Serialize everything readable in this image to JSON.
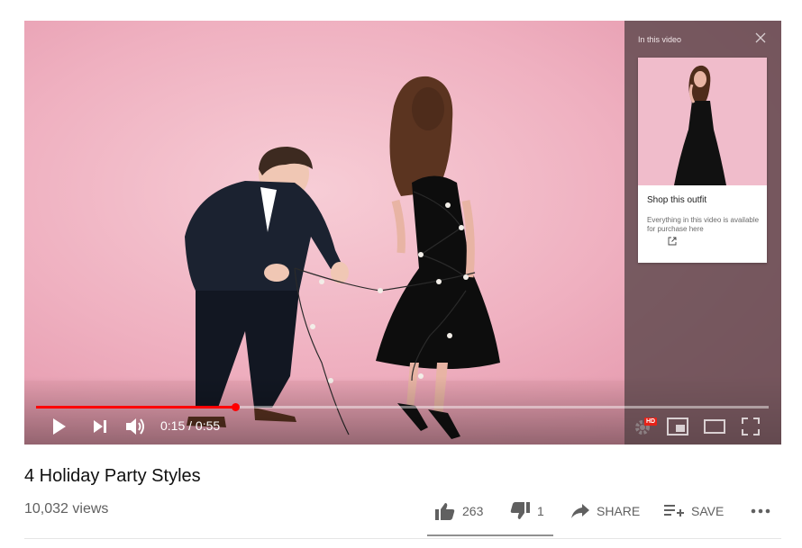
{
  "player": {
    "progress_fraction": 0.272,
    "time_current": "0:15",
    "time_separator": " / ",
    "time_total": "0:55",
    "hd_badge": "HD"
  },
  "shop_panel": {
    "title": "In this video",
    "card_title": "Shop this outfit",
    "card_description": "Everything in this video is available for purchase here"
  },
  "video": {
    "title": "4 Holiday Party Styles",
    "views": "10,032 views"
  },
  "actions": {
    "like_count": "263",
    "dislike_count": "1",
    "share_label": "SHARE",
    "save_label": "SAVE"
  },
  "icons": [
    "play-icon",
    "next-icon",
    "volume-icon",
    "settings-icon",
    "miniplayer-icon",
    "theater-icon",
    "fullscreen-icon",
    "close-icon",
    "external-link-icon",
    "like-icon",
    "dislike-icon",
    "share-icon",
    "playlist-add-icon",
    "more-icon"
  ],
  "colors": {
    "progress": "#ff0000",
    "video_background": "#efb0bf",
    "muted_text": "#606060"
  }
}
